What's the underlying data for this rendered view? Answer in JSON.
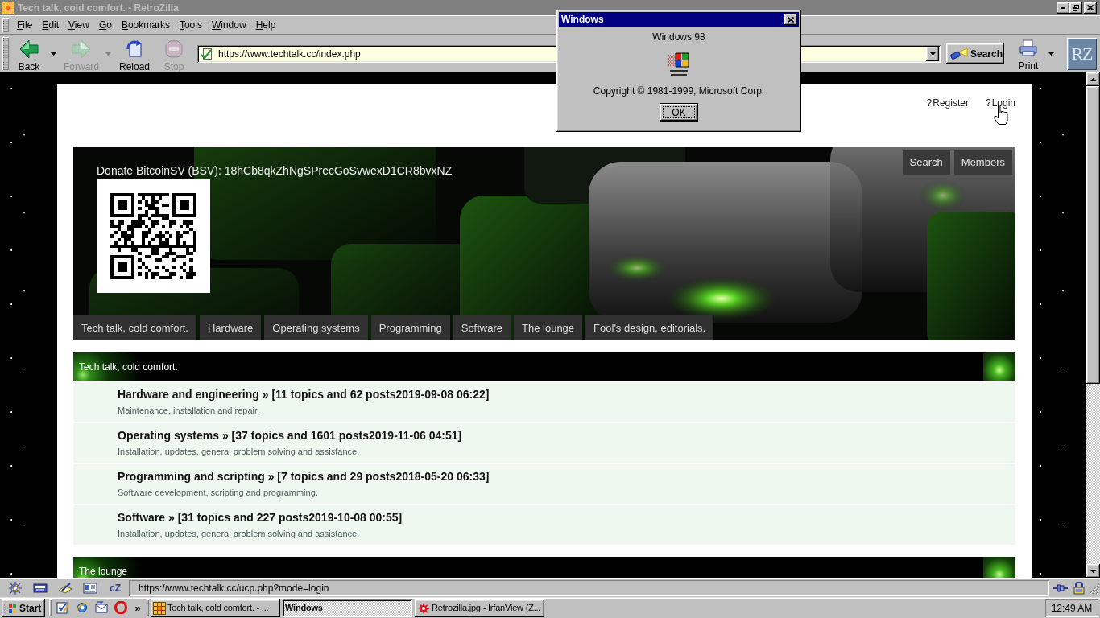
{
  "window": {
    "title": "Tech talk, cold comfort. - RetroZilla"
  },
  "menu": [
    "File",
    "Edit",
    "View",
    "Go",
    "Bookmarks",
    "Tools",
    "Window",
    "Help"
  ],
  "toolbar": {
    "buttons": [
      {
        "label": "Back",
        "disabled": false,
        "dropdown": true
      },
      {
        "label": "Forward",
        "disabled": true,
        "dropdown": true
      },
      {
        "label": "Reload",
        "disabled": false,
        "dropdown": false
      },
      {
        "label": "Stop",
        "disabled": true,
        "dropdown": false
      }
    ],
    "address": "https://www.techtalk.cc/index.php",
    "search_button": "Search",
    "print_button": {
      "label": "Print",
      "dropdown": true
    },
    "logo": "RZ"
  },
  "page": {
    "header_links": [
      {
        "glyph": "?",
        "label": "Register"
      },
      {
        "glyph": "?",
        "label": "Login"
      }
    ],
    "donate": "Donate BitcoinSV (BSV): 18hCb8qkZhNgSPrecGoSvwexD1CR8bvxNZ",
    "banner_buttons": [
      "Search",
      "Members"
    ],
    "nav_tabs": [
      "Tech talk, cold comfort.",
      "Hardware",
      "Operating systems",
      "Programming",
      "Software",
      "The lounge",
      "Fool's design, editorials."
    ],
    "categories": [
      {
        "title": "Tech talk, cold comfort.",
        "forums": [
          {
            "title": "Hardware and engineering » [11 topics and 62 posts2019-09-08 06:22]",
            "description": "Maintenance, installation and repair."
          },
          {
            "title": "Operating systems » [37 topics and 1601 posts2019-11-06 04:51]",
            "description": "Installation, updates, general problem solving and assistance."
          },
          {
            "title": "Programming and scripting » [7 topics and 29 posts2018-05-20 06:33]",
            "description": "Software development, scripting and programming."
          },
          {
            "title": "Software » [31 topics and 227 posts2019-10-08 00:55]",
            "description": "Installation, updates, general problem solving and assistance."
          }
        ]
      },
      {
        "title": "The lounge"
      }
    ]
  },
  "status_bar": {
    "chat_button": "cZ",
    "url": "https://www.techtalk.cc/ucp.php?mode=login"
  },
  "taskbar": {
    "start": "Start",
    "more": "»",
    "tasks": [
      {
        "label": "Tech talk, cold comfort. - ...",
        "selected": false
      },
      {
        "label": "Windows",
        "selected": true
      },
      {
        "label": "Retrozilla.jpg - IrfanView (Z...",
        "selected": false
      }
    ],
    "clock": "12:49 AM"
  },
  "dialog": {
    "title": "Windows",
    "heading": "Windows 98",
    "copyright": "Copyright © 1981-1999, Microsoft Corp.",
    "button": "OK"
  }
}
